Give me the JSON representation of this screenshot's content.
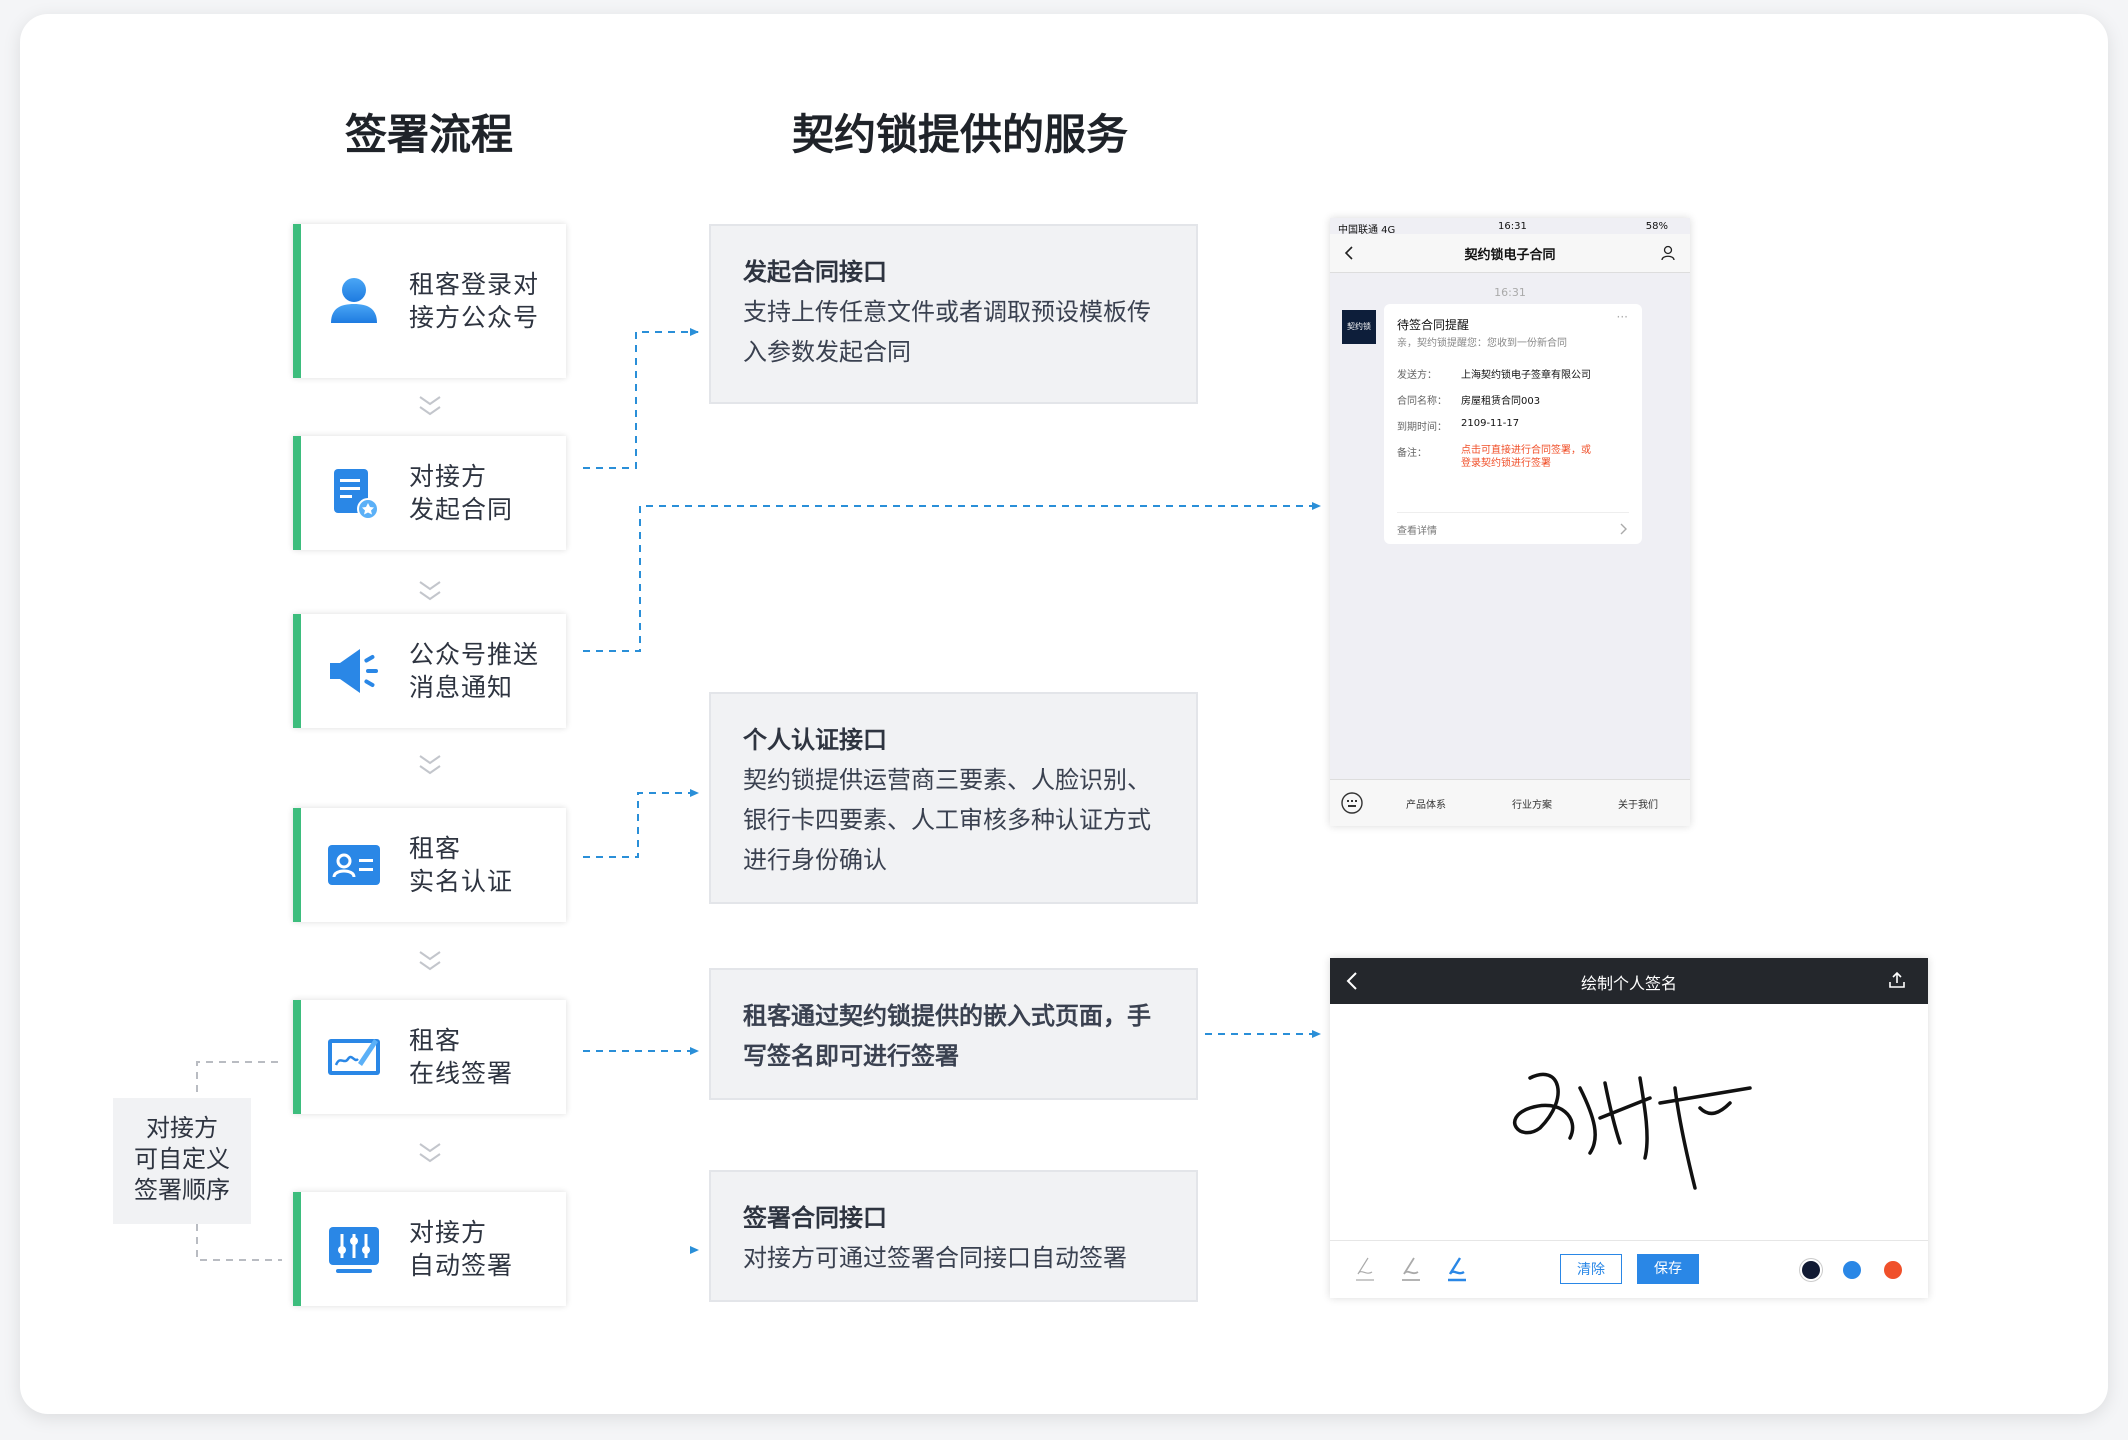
{
  "headings": {
    "flow": "签署流程",
    "services": "契约锁提供的服务"
  },
  "steps": [
    {
      "line1": "租客登录对",
      "line2": "接方公众号",
      "icon": "user-icon"
    },
    {
      "line1": "对接方",
      "line2": "发起合同",
      "icon": "document-icon"
    },
    {
      "line1": "公众号推送",
      "line2": "消息通知",
      "icon": "megaphone-icon"
    },
    {
      "line1": "租客",
      "line2": "实名认证",
      "icon": "id-card-icon"
    },
    {
      "line1": "租客",
      "line2": "在线签署",
      "icon": "pen-tablet-icon"
    },
    {
      "line1": "对接方",
      "line2": "自动签署",
      "icon": "sliders-icon"
    }
  ],
  "custom_order": {
    "line1": "对接方",
    "line2": "可自定义",
    "line3": "签署顺序"
  },
  "services": [
    {
      "title": "发起合同接口",
      "desc": "支持上传任意文件或者调取预设模板传\n入参数发起合同"
    },
    {
      "title": "个人认证接口",
      "desc": "契约锁提供运营商三要素、人脸识别、\n银行卡四要素、人工审核多种认证方式\n进行身份确认"
    },
    {
      "title": "",
      "desc": "租客通过契约锁提供的嵌入式页面，手\n写签名即可进行签署"
    },
    {
      "title": "签署合同接口",
      "desc": "对接方可通过签署合同接口自动签署"
    }
  ],
  "phone": {
    "carrier": "中国联通 4G",
    "clock": "16:31",
    "battery": "58%",
    "title": "契约锁电子合同",
    "time": "16:31",
    "avatar_text": "契约锁",
    "msg_title": "待签合同提醒",
    "msg_sub": "亲，契约锁提醒您：您收到一份新合同",
    "rows": [
      {
        "k": "发送方：",
        "v": "上海契约锁电子签章有限公司"
      },
      {
        "k": "合同名称：",
        "v": "房屋租赁合同003"
      },
      {
        "k": "到期时间：",
        "v": "2109-11-17"
      },
      {
        "k": "备注：",
        "v": "点击可直接进行合同签署，或\n登录契约锁进行签署"
      }
    ],
    "more": "查看详情",
    "menu": [
      "产品体系",
      "行业方案",
      "关于我们"
    ]
  },
  "signature": {
    "title": "绘制个人签名",
    "clear": "清除",
    "save": "保存",
    "colors": [
      "#111a33",
      "#2a87e6",
      "#f0502a"
    ]
  },
  "colors": {
    "accent_green": "#3dbd7d",
    "icon_blue": "#2a87e6",
    "connector_blue": "#2a8fd8"
  }
}
